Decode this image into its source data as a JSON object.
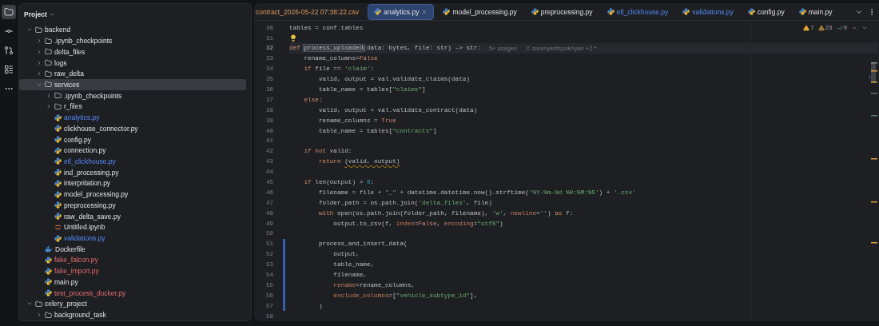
{
  "toolbar": {
    "items": [
      {
        "kind": "project",
        "selected": true
      },
      {
        "kind": "commit",
        "selected": false
      },
      {
        "kind": "pull-requests",
        "selected": false
      },
      {
        "kind": "structure",
        "selected": false
      },
      {
        "kind": "more",
        "selected": false
      }
    ]
  },
  "project_panel": {
    "title": "Project",
    "tree": [
      {
        "name": "backend",
        "kind": "folder",
        "expanded": true,
        "selected": false,
        "children": [
          {
            "name": ".ipynb_checkpoints",
            "kind": "folder",
            "expanded": false,
            "selected": false
          },
          {
            "name": "delta_files",
            "kind": "folder",
            "expanded": false,
            "selected": false
          },
          {
            "name": "logs",
            "kind": "folder",
            "expanded": false,
            "selected": false
          },
          {
            "name": "raw_delta",
            "kind": "folder",
            "expanded": false,
            "selected": false
          },
          {
            "name": "services",
            "kind": "folder",
            "expanded": true,
            "selected": true,
            "children": [
              {
                "name": ".ipynb_checkpoints",
                "kind": "folder",
                "expanded": false,
                "selected": false
              },
              {
                "name": "r_files",
                "kind": "folder",
                "expanded": false,
                "selected": false
              },
              {
                "name": "analytics.py",
                "kind": "python",
                "selected": false,
                "modified": true,
                "untracked": false
              },
              {
                "name": "clickhouse_connector.py",
                "kind": "python",
                "selected": false,
                "modified": false,
                "untracked": false
              },
              {
                "name": "config.py",
                "kind": "python",
                "selected": false,
                "modified": false,
                "untracked": false
              },
              {
                "name": "connection.py",
                "kind": "python",
                "selected": false,
                "modified": false,
                "untracked": false
              },
              {
                "name": "etl_clickhouse.py",
                "kind": "python",
                "selected": false,
                "modified": true,
                "untracked": false
              },
              {
                "name": "ind_processing.py",
                "kind": "python",
                "selected": false,
                "modified": false,
                "untracked": false
              },
              {
                "name": "interpritation.py",
                "kind": "python",
                "selected": false,
                "modified": false,
                "untracked": false
              },
              {
                "name": "model_processing.py",
                "kind": "python",
                "selected": false,
                "modified": false,
                "untracked": false
              },
              {
                "name": "preprocessing.py",
                "kind": "python",
                "selected": false,
                "modified": false,
                "untracked": false
              },
              {
                "name": "raw_delta_save.py",
                "kind": "python",
                "selected": false,
                "modified": false,
                "untracked": false
              },
              {
                "name": "Untitled.ipynb",
                "kind": "notebook",
                "selected": false,
                "modified": false,
                "untracked": false
              },
              {
                "name": "validations.py",
                "kind": "python",
                "selected": false,
                "modified": true,
                "untracked": false
              }
            ]
          },
          {
            "name": "Dockerfile",
            "kind": "docker",
            "selected": false,
            "modified": false,
            "untracked": false
          },
          {
            "name": "fake_falcon.py",
            "kind": "python",
            "selected": false,
            "modified": false,
            "untracked": true
          },
          {
            "name": "fake_import.py",
            "kind": "python",
            "selected": false,
            "modified": false,
            "untracked": true
          },
          {
            "name": "main.py",
            "kind": "python",
            "selected": false,
            "modified": false,
            "untracked": false
          },
          {
            "name": "test_process_docker.py",
            "kind": "python",
            "selected": false,
            "modified": false,
            "untracked": true
          }
        ]
      },
      {
        "name": "celery_project",
        "kind": "folder",
        "expanded": true,
        "selected": false,
        "children": [
          {
            "name": "background_task",
            "kind": "folder",
            "expanded": false,
            "selected": false
          }
        ]
      }
    ]
  },
  "editor": {
    "tabs": [
      {
        "label": "contract_2026-05-22 07:38:22.csv",
        "kind": "csv",
        "selected": false,
        "modified": false,
        "ignored": true
      },
      {
        "label": "analytics.py",
        "kind": "python",
        "selected": true,
        "modified": false,
        "ignored": false
      },
      {
        "label": "model_processing.py",
        "kind": "python",
        "selected": false,
        "modified": false,
        "ignored": false
      },
      {
        "label": "preprocessing.py",
        "kind": "python",
        "selected": false,
        "modified": false,
        "ignored": false
      },
      {
        "label": "etl_clickhouse.py",
        "kind": "python",
        "selected": false,
        "modified": true,
        "ignored": false
      },
      {
        "label": "validations.py",
        "kind": "python",
        "selected": false,
        "modified": true,
        "ignored": false
      },
      {
        "label": "config.py",
        "kind": "python",
        "selected": false,
        "modified": false,
        "ignored": false
      },
      {
        "label": "main.py",
        "kind": "python",
        "selected": false,
        "modified": false,
        "ignored": false
      }
    ],
    "inspections": [
      {
        "kind": "warning",
        "count": "7"
      },
      {
        "kind": "weak-warning",
        "count": "23"
      },
      {
        "kind": "typo",
        "count": "9"
      }
    ],
    "lines": [
      {
        "number": "30",
        "kind": "code",
        "changed": false,
        "tokens": [
          {
            "t": "tables = conf.tables",
            "kind": "plain"
          }
        ]
      },
      {
        "number": "31",
        "kind": "hint",
        "changed": false
      },
      {
        "number": "32",
        "kind": "current",
        "changed": false,
        "tokens": [
          {
            "t": "def ",
            "kind": "keyword"
          },
          {
            "t": "process_uploaded",
            "kind": "highlight"
          },
          {
            "t": "(data: bytes, file: str) -> str:",
            "kind": "plain"
          },
          {
            "t": "5+ usages",
            "kind": "usages"
          },
          {
            "t": "surenyeritspokhyan +2 *",
            "kind": "author"
          }
        ]
      },
      {
        "number": "33",
        "kind": "code",
        "changed": false,
        "tokens": [
          {
            "t": "    rename_columns=",
            "kind": "plain"
          },
          {
            "t": "False",
            "kind": "keyword"
          }
        ]
      },
      {
        "number": "34",
        "kind": "code",
        "changed": false,
        "tokens": [
          {
            "t": "    if",
            "kind": "keyword"
          },
          {
            "t": " file == ",
            "kind": "plain"
          },
          {
            "t": "'claim'",
            "kind": "string"
          },
          {
            "t": ":",
            "kind": "plain"
          }
        ]
      },
      {
        "number": "35",
        "kind": "code",
        "changed": false,
        "tokens": [
          {
            "t": "        valid, output = val.validate_claims(data)",
            "kind": "plain"
          }
        ]
      },
      {
        "number": "36",
        "kind": "code",
        "changed": false,
        "tokens": [
          {
            "t": "        table_name = tables[",
            "kind": "plain"
          },
          {
            "t": "\"claims\"",
            "kind": "string"
          },
          {
            "t": "]",
            "kind": "plain"
          }
        ]
      },
      {
        "number": "37",
        "kind": "code",
        "changed": false,
        "tokens": [
          {
            "t": "    else",
            "kind": "keyword"
          },
          {
            "t": ":",
            "kind": "plain"
          }
        ]
      },
      {
        "number": "38",
        "kind": "code",
        "changed": false,
        "tokens": [
          {
            "t": "        valid, output = val.validate_contract(data)",
            "kind": "plain"
          }
        ]
      },
      {
        "number": "39",
        "kind": "code",
        "changed": false,
        "tokens": [
          {
            "t": "        rename_columns = ",
            "kind": "plain"
          },
          {
            "t": "True",
            "kind": "keyword"
          }
        ]
      },
      {
        "number": "40",
        "kind": "code",
        "changed": false,
        "tokens": [
          {
            "t": "        table_name = tables[",
            "kind": "plain"
          },
          {
            "t": "\"contracts\"",
            "kind": "string"
          },
          {
            "t": "]",
            "kind": "plain"
          }
        ]
      },
      {
        "number": "41",
        "kind": "code",
        "changed": false
      },
      {
        "number": "42",
        "kind": "code",
        "changed": false,
        "tokens": [
          {
            "t": "    if not",
            "kind": "keyword"
          },
          {
            "t": " valid:",
            "kind": "plain"
          }
        ]
      },
      {
        "number": "43",
        "kind": "code",
        "changed": false,
        "tokens": [
          {
            "t": "        return ",
            "kind": "keyword"
          },
          {
            "t": "(valid, output)",
            "kind": "warning"
          }
        ]
      },
      {
        "number": "44",
        "kind": "code",
        "changed": false
      },
      {
        "number": "45",
        "kind": "code",
        "changed": false,
        "tokens": [
          {
            "t": "    if",
            "kind": "keyword"
          },
          {
            "t": " len(output) > ",
            "kind": "plain"
          },
          {
            "t": "0",
            "kind": "number"
          },
          {
            "t": ":",
            "kind": "plain"
          }
        ]
      },
      {
        "number": "46",
        "kind": "code",
        "changed": false,
        "tokens": [
          {
            "t": "        filename = file + ",
            "kind": "plain"
          },
          {
            "t": "\"_\"",
            "kind": "string"
          },
          {
            "t": " + datetime.datetime.now().strftime(",
            "kind": "plain"
          },
          {
            "t": "'%Y-%m-%d %H:%M:%S'",
            "kind": "string"
          },
          {
            "t": ") + ",
            "kind": "plain"
          },
          {
            "t": "'.csv'",
            "kind": "string"
          }
        ]
      },
      {
        "number": "47",
        "kind": "code",
        "changed": false,
        "tokens": [
          {
            "t": "        folder_path = os.path.join(",
            "kind": "plain"
          },
          {
            "t": "'delta_files'",
            "kind": "string"
          },
          {
            "t": ", file)",
            "kind": "plain"
          }
        ]
      },
      {
        "number": "48",
        "kind": "code",
        "changed": false,
        "tokens": [
          {
            "t": "        with",
            "kind": "keyword"
          },
          {
            "t": " open(os.path.join(folder_path, filename), ",
            "kind": "plain"
          },
          {
            "t": "'w'",
            "kind": "string"
          },
          {
            "t": ", ",
            "kind": "plain"
          },
          {
            "t": "newline",
            "kind": "argument"
          },
          {
            "t": "=",
            "kind": "plain"
          },
          {
            "t": "''",
            "kind": "string"
          },
          {
            "t": ") ",
            "kind": "plain"
          },
          {
            "t": "as",
            "kind": "keyword"
          },
          {
            "t": " f:",
            "kind": "plain"
          }
        ]
      },
      {
        "number": "49",
        "kind": "code",
        "changed": false,
        "tokens": [
          {
            "t": "            output.to_csv(f, ",
            "kind": "plain"
          },
          {
            "t": "index",
            "kind": "argument"
          },
          {
            "t": "=",
            "kind": "plain"
          },
          {
            "t": "False",
            "kind": "keyword"
          },
          {
            "t": ", ",
            "kind": "plain"
          },
          {
            "t": "encoding",
            "kind": "argument"
          },
          {
            "t": "=",
            "kind": "plain"
          },
          {
            "t": "\"utf8\"",
            "kind": "string"
          },
          {
            "t": ")",
            "kind": "plain"
          }
        ]
      },
      {
        "number": "50",
        "kind": "code",
        "changed": false
      },
      {
        "number": "51",
        "kind": "code",
        "changed": true,
        "tokens": [
          {
            "t": "        process_and_insert_data(",
            "kind": "plain"
          }
        ]
      },
      {
        "number": "52",
        "kind": "code",
        "changed": true,
        "tokens": [
          {
            "t": "            output,",
            "kind": "plain"
          }
        ]
      },
      {
        "number": "53",
        "kind": "code",
        "changed": true,
        "tokens": [
          {
            "t": "            table_name,",
            "kind": "plain"
          }
        ]
      },
      {
        "number": "54",
        "kind": "code",
        "changed": true,
        "tokens": [
          {
            "t": "            filename,",
            "kind": "plain"
          }
        ]
      },
      {
        "number": "55",
        "kind": "code",
        "changed": true,
        "tokens": [
          {
            "t": "            rename",
            "kind": "argument"
          },
          {
            "t": "=rename_columns,",
            "kind": "plain"
          }
        ]
      },
      {
        "number": "56",
        "kind": "code",
        "changed": true,
        "tokens": [
          {
            "t": "            exclude_columns",
            "kind": "argument"
          },
          {
            "t": "=[",
            "kind": "plain"
          },
          {
            "t": "\"vehicle_subtype_id\"",
            "kind": "string"
          },
          {
            "t": "],",
            "kind": "plain"
          }
        ]
      },
      {
        "number": "57",
        "kind": "code",
        "changed": true,
        "tokens": [
          {
            "t": "        )",
            "kind": "plain"
          }
        ]
      },
      {
        "number": "58",
        "kind": "code",
        "changed": false
      }
    ]
  }
}
